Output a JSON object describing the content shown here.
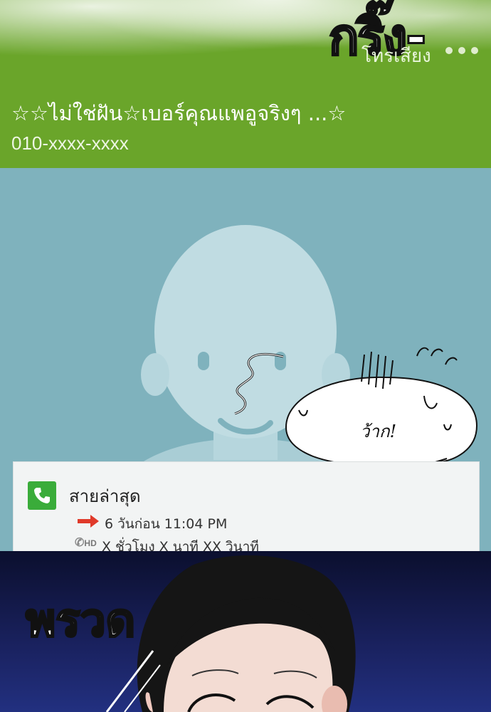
{
  "header": {
    "sfx_ring": "กริ๊ง-",
    "calling_label": "โทรเสียง",
    "caller_name": "☆☆ไม่ใช่ฝัน☆เบอร์คุณแพอูจริงๆ ...☆",
    "caller_number": "010-xxxx-xxxx"
  },
  "bubble": {
    "sfx_wow": "ว้าก!"
  },
  "recent_calls": {
    "title": "สายล่าสุด",
    "last_call": "6 วันก่อน 11:04 PM",
    "hd_label": "HD",
    "duration": "X ชั่วโมง X นาที XX วินาที"
  },
  "panel2": {
    "sfx_whoosh": "พรวด"
  },
  "colors": {
    "header_green": "#6aa52a",
    "photo_bg": "#7fb2bd",
    "night_bg": "#1a2260",
    "call_icon_green": "#3aac3a",
    "arrow_red": "#e03a2a"
  }
}
